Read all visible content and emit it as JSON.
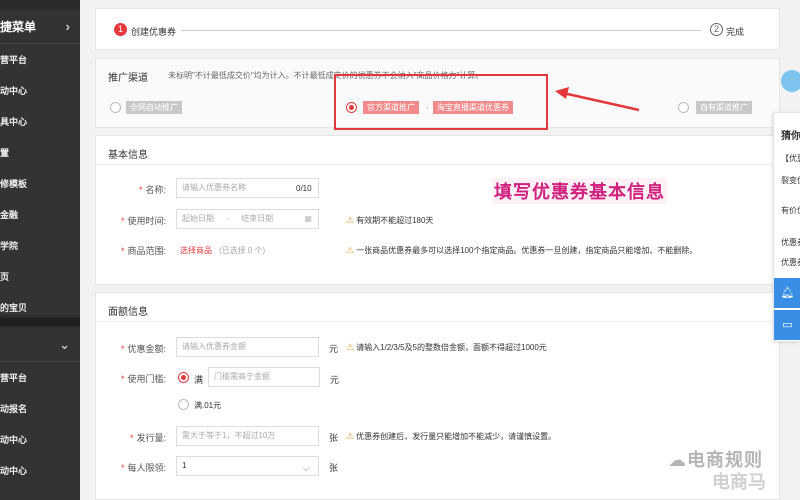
{
  "sidebar": {
    "group1_title": "捷菜单",
    "group1_items": [
      "营平台",
      "动中心",
      "具中心",
      "置",
      "修模板",
      "金融",
      "学院",
      "页",
      "的宝贝"
    ],
    "group2_title": "",
    "group2_items": [
      "营平台",
      "动报名",
      "动中心",
      "动中心"
    ]
  },
  "steps": {
    "step1_num": "1",
    "step1_label": "创建优惠券",
    "step2_num": "2",
    "step2_label": "完成"
  },
  "channel": {
    "title": "推广渠道",
    "note": "未标明\"不计最低成交价\"均为计入。不计最低成交价的优惠券不会纳入\"商品价格力\"计算。",
    "opt1": "全网自动推广",
    "opt2a": "官方渠道推广",
    "opt2_sep": "-",
    "opt2b": "淘宝直播渠道优惠券",
    "opt3": "自有渠道推广"
  },
  "basic": {
    "title": "基本信息",
    "name_label": "名称:",
    "name_placeholder": "请输入优惠券名称",
    "name_counter": "0/10",
    "time_label": "使用时间:",
    "time_start": "起始日期",
    "time_sep": "-",
    "time_end": "结束日期",
    "time_warn": "有效期不能超过180天",
    "scope_label": "商品范围:",
    "scope_link": "选择商品",
    "scope_count": "(已选择 0 个)",
    "scope_warn": "一张商品优惠券最多可以选择100个指定商品。优惠券一旦创建，指定商品只能增加、不能删除。",
    "annotation": "填写优惠券基本信息"
  },
  "amount": {
    "title": "面额信息",
    "amount_label": "优惠金额:",
    "amount_placeholder": "请输入优惠券金额",
    "amount_unit": "元",
    "amount_warn": "请输入1/2/3/5及5的整数倍金额，面额不得超过1000元",
    "threshold_label": "使用门槛:",
    "threshold_opt1": "满",
    "threshold_placeholder": "门槛需高于金额",
    "threshold_unit": "元",
    "threshold_opt2": "满.01元",
    "issue_label": "发行量:",
    "issue_placeholder": "需大于等于1，不超过10万",
    "issue_unit": "张",
    "issue_warn": "优惠券创建后，发行量只能增加不能减少，请谨慎设置。",
    "limit_label": "每人限领:",
    "limit_value": "1",
    "limit_unit": "张"
  },
  "side_widget": {
    "title": "猜你",
    "lines": [
      "【优惠",
      "裂变优",
      "有价优",
      "优惠券",
      "优惠券"
    ],
    "bell_icon": "bell-icon",
    "chat_icon": "chat-icon"
  },
  "watermark": {
    "line1": "电商规则",
    "line2": "电商马"
  },
  "colors": {
    "accent": "#e4393c",
    "annotation": "#d0217e",
    "widget_blue": "#3a8ee6"
  }
}
